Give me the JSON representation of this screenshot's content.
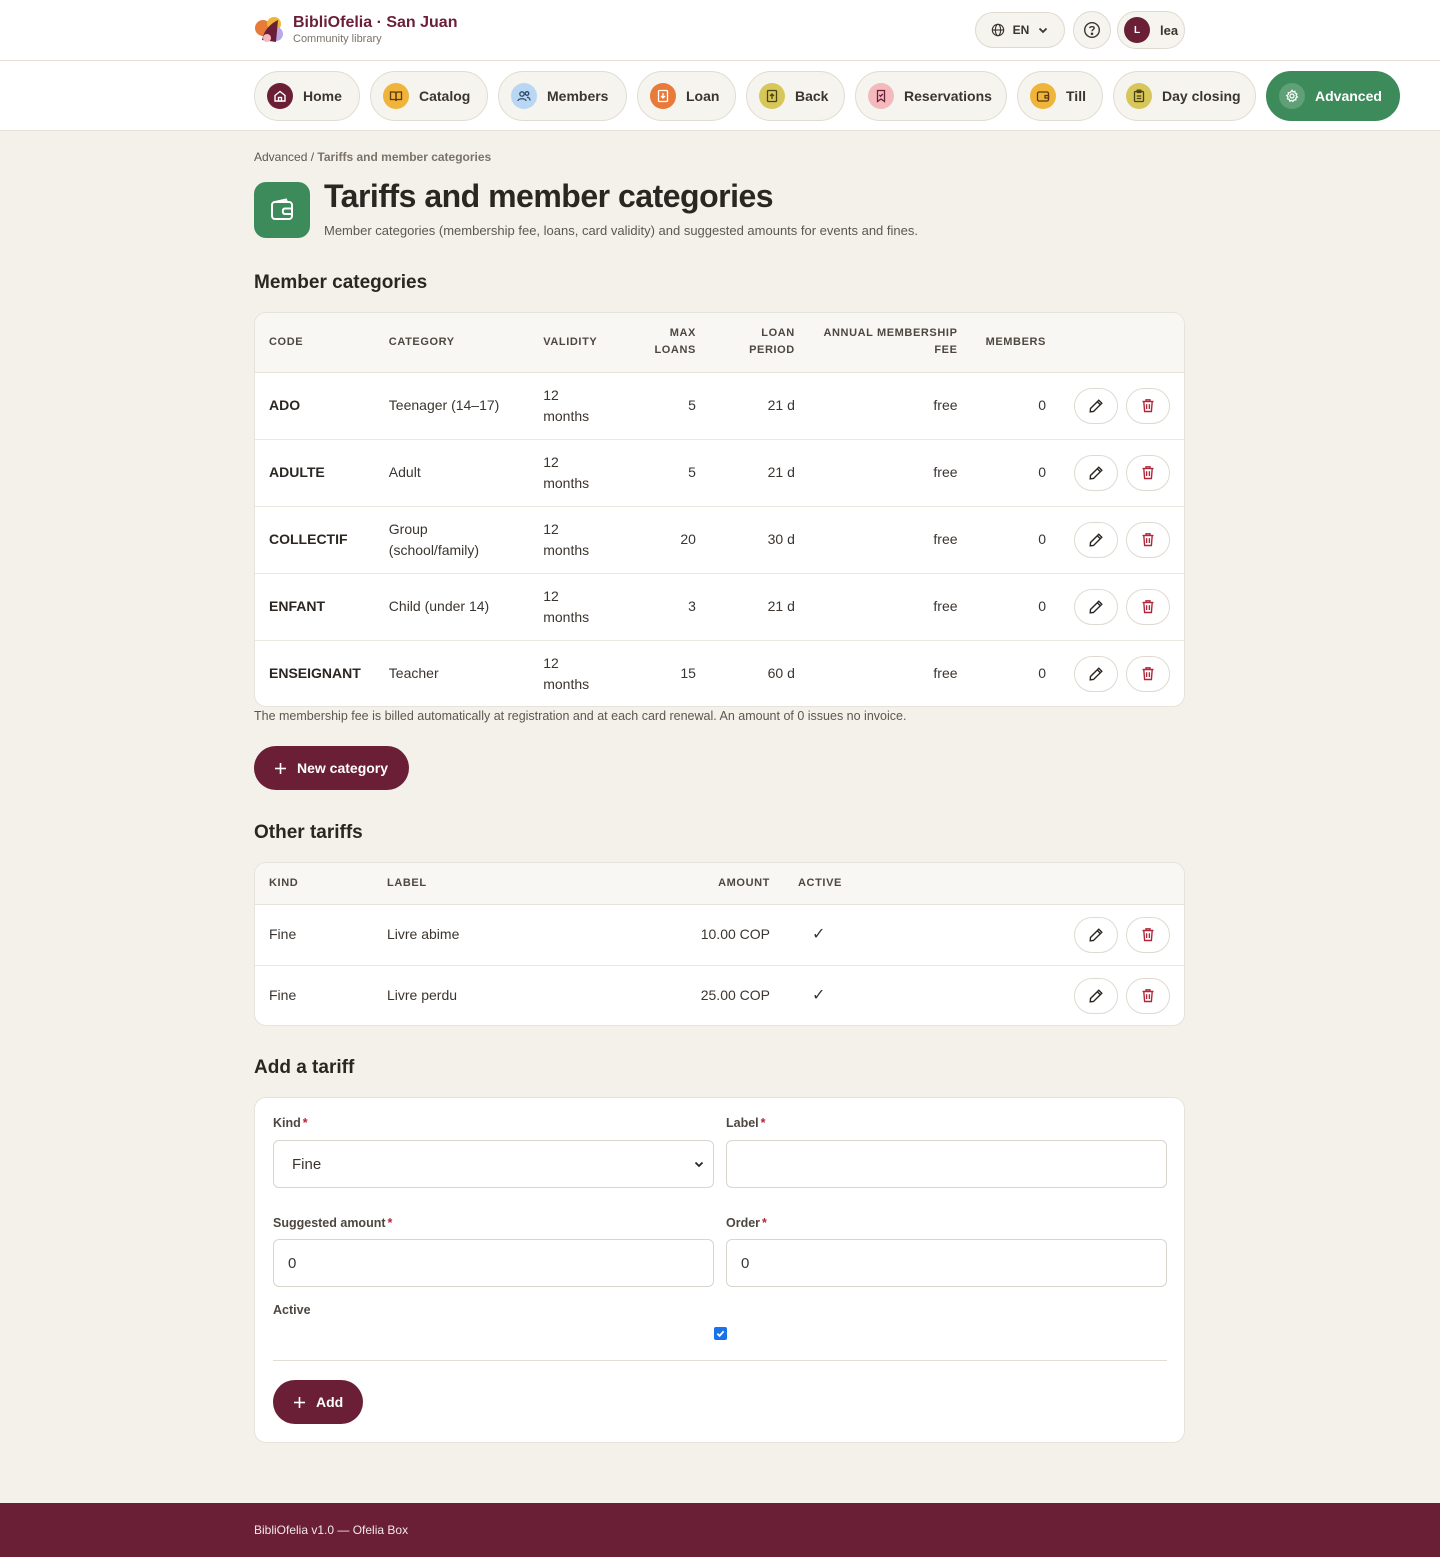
{
  "brand": {
    "title": "BibliOfelia · San Juan",
    "subtitle": "Community library"
  },
  "topbar": {
    "language": "EN",
    "user_initial": "L",
    "user_name": "lea"
  },
  "nav": [
    {
      "label": "Home",
      "icon": "home-icon",
      "color": "#6b1f37"
    },
    {
      "label": "Catalog",
      "icon": "book-open-icon",
      "color": "#f0b43a"
    },
    {
      "label": "Members",
      "icon": "users-icon",
      "color": "#b9d7f2"
    },
    {
      "label": "Loan",
      "icon": "loan-icon",
      "color": "#e87a3a"
    },
    {
      "label": "Back",
      "icon": "return-icon",
      "color": "#d7c65a"
    },
    {
      "label": "Reservations",
      "icon": "bookmark-icon",
      "color": "#f4b9bd"
    },
    {
      "label": "Till",
      "icon": "wallet-icon",
      "color": "#f0b43a"
    },
    {
      "label": "Day closing",
      "icon": "clipboard-icon",
      "color": "#d7c65a"
    },
    {
      "label": "Advanced",
      "icon": "gear-icon",
      "color": "#3d8b5a"
    }
  ],
  "breadcrumb": {
    "parent": "Advanced",
    "separator": " / ",
    "current": "Tariffs and member categories"
  },
  "page": {
    "title": "Tariffs and member categories",
    "subtitle": "Member categories (membership fee, loans, card validity) and suggested amounts for events and fines."
  },
  "categories": {
    "title": "Member categories",
    "headers": {
      "code": "Code",
      "category": "Category",
      "validity": "Validity",
      "max_loans_1": "Max",
      "max_loans_2": "loans",
      "loan_period_1": "Loan",
      "loan_period_2": "period",
      "fee_1": "Annual membership",
      "fee_2": "fee",
      "members": "Members"
    },
    "rows": [
      {
        "code": "ADO",
        "category_1": "Teenager (14–17)",
        "category_2": "",
        "validity_1": "12",
        "validity_2": "months",
        "max_loans": "5",
        "loan_period": "21 d",
        "fee": "free",
        "members": "0"
      },
      {
        "code": "ADULTE",
        "category_1": "Adult",
        "category_2": "",
        "validity_1": "12",
        "validity_2": "months",
        "max_loans": "5",
        "loan_period": "21 d",
        "fee": "free",
        "members": "0"
      },
      {
        "code": "COLLECTIF",
        "category_1": "Group",
        "category_2": "(school/family)",
        "validity_1": "12",
        "validity_2": "months",
        "max_loans": "20",
        "loan_period": "30 d",
        "fee": "free",
        "members": "0"
      },
      {
        "code": "ENFANT",
        "category_1": "Child (under 14)",
        "category_2": "",
        "validity_1": "12",
        "validity_2": "months",
        "max_loans": "3",
        "loan_period": "21 d",
        "fee": "free",
        "members": "0"
      },
      {
        "code": "ENSEIGNANT",
        "category_1": "Teacher",
        "category_2": "",
        "validity_1": "12",
        "validity_2": "months",
        "max_loans": "15",
        "loan_period": "60 d",
        "fee": "free",
        "members": "0"
      }
    ],
    "note": "The membership fee is billed automatically at registration and at each card renewal. An amount of 0 issues no invoice.",
    "new_button": "New category"
  },
  "tariffs": {
    "title": "Other tariffs",
    "headers": {
      "kind": "Kind",
      "label": "Label",
      "amount": "Amount",
      "active": "Active"
    },
    "rows": [
      {
        "kind": "Fine",
        "label": "Livre abime",
        "amount": "10.00 COP",
        "active": "✓"
      },
      {
        "kind": "Fine",
        "label": "Livre perdu",
        "amount": "25.00 COP",
        "active": "✓"
      }
    ]
  },
  "add_tariff": {
    "title": "Add a tariff",
    "kind_label": "Kind",
    "kind_value": "Fine",
    "label_label": "Label",
    "label_value": "",
    "amount_label": "Suggested amount",
    "amount_value": "0",
    "order_label": "Order",
    "order_value": "0",
    "active_label": "Active",
    "active_checked": true,
    "required_mark": "*",
    "add_button": "Add"
  },
  "footer": {
    "text": "BibliOfelia v1.0 — Ofelia Box"
  },
  "colors": {
    "brand": "#6b1f37",
    "accent_green": "#3d8b5a",
    "danger": "#b3263a"
  }
}
